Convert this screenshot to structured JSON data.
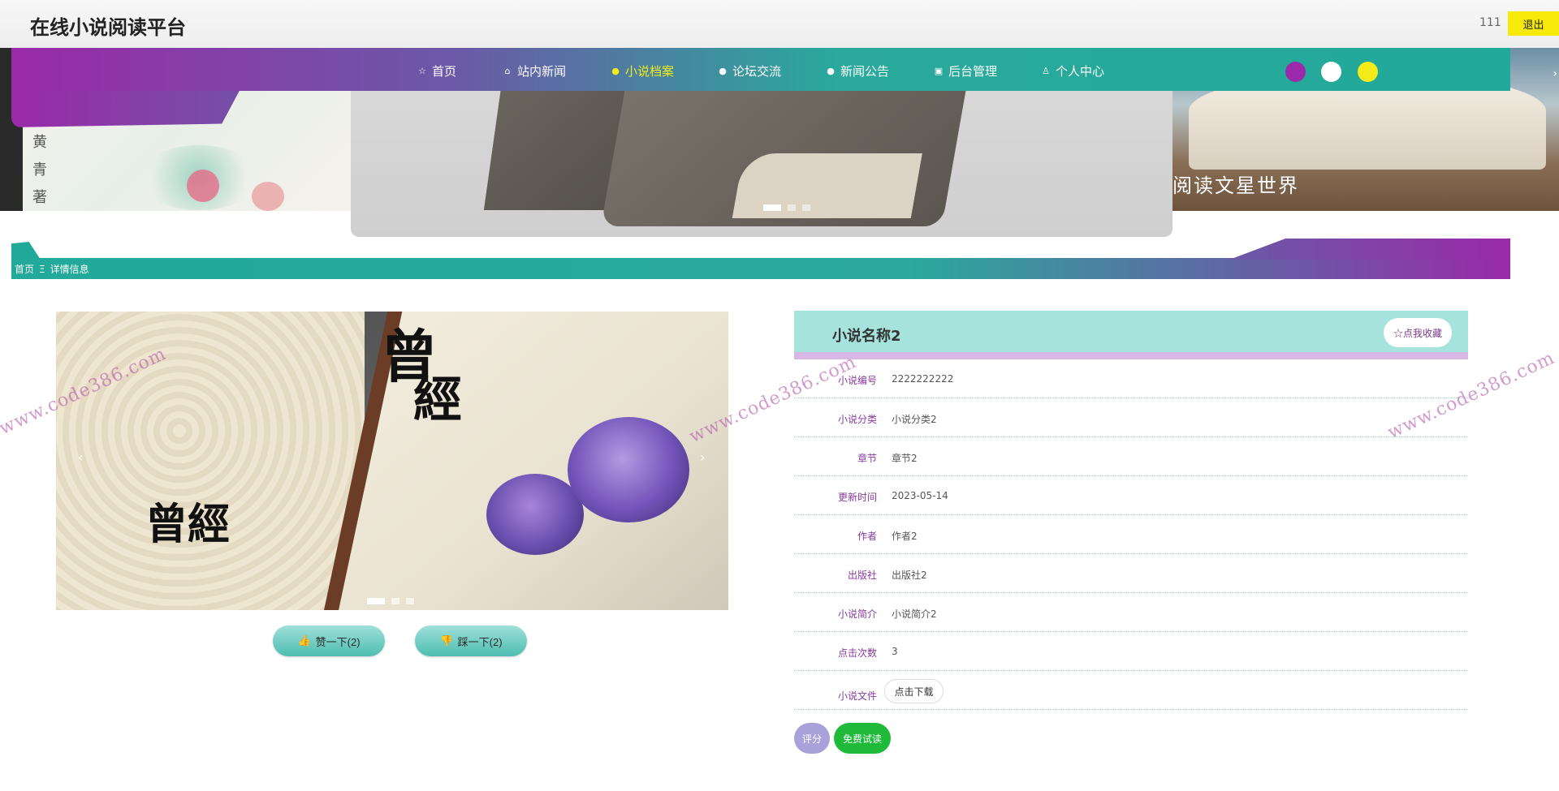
{
  "header": {
    "site_title": "在线小说阅读平台",
    "username": "111",
    "logout_label": "退出"
  },
  "nav": {
    "items": [
      {
        "label": "首页",
        "icon": "star-icon"
      },
      {
        "label": "站内新闻",
        "icon": "bag-icon"
      },
      {
        "label": "小说档案",
        "icon": "info-icon"
      },
      {
        "label": "论坛交流",
        "icon": "question-icon"
      },
      {
        "label": "新闻公告",
        "icon": "info-icon"
      },
      {
        "label": "后台管理",
        "icon": "briefcase-icon"
      },
      {
        "label": "个人中心",
        "icon": "user-icon"
      }
    ],
    "active_index": 2,
    "theme_swatches": [
      "#9a2aa9",
      "#ffffff",
      "#f3ec19"
    ]
  },
  "hero": {
    "left_vertical_text": "黄 青 著",
    "right_text": "阅读文星世界"
  },
  "breadcrumb": {
    "home": "首页",
    "separator": "Ξ",
    "current": "详情信息"
  },
  "gallery": {
    "cover_title": "曾經",
    "dot_count": 3,
    "active_dot": 0
  },
  "votes": {
    "like_label": "赞一下(2)",
    "dislike_label": "踩一下(2)"
  },
  "novel": {
    "title": "小说名称2",
    "favorite_label": "☆点我收藏",
    "fields": [
      {
        "label": "小说编号",
        "value": "2222222222"
      },
      {
        "label": "小说分类",
        "value": "小说分类2"
      },
      {
        "label": "章节",
        "value": "章节2"
      },
      {
        "label": "更新时间",
        "value": "2023-05-14"
      },
      {
        "label": "作者",
        "value": "作者2"
      },
      {
        "label": "出版社",
        "value": "出版社2"
      },
      {
        "label": "小说简介",
        "value": "小说简介2"
      },
      {
        "label": "点击次数",
        "value": "3"
      }
    ],
    "file_label": "小说文件",
    "download_label": "点击下载",
    "rate_label": "评分",
    "free_read_label": "免费试读"
  },
  "watermark": "www.code386.com",
  "colors": {
    "accent_teal": "#21a99a",
    "accent_purple": "#9a2aa9",
    "active_yellow": "#f3ec19",
    "logout_yellow": "#f7ea0a",
    "read_green": "#1fba3a"
  }
}
